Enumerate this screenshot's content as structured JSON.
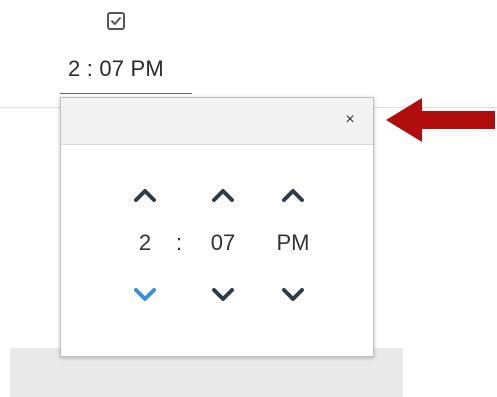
{
  "field": {
    "time_display": "2 : 07 PM",
    "checkbox_checked": true
  },
  "picker": {
    "close_label": "×",
    "hour": "2",
    "separator": ":",
    "minute": "07",
    "meridian": "PM"
  },
  "icons": {
    "up": "chevron-up-icon",
    "down": "chevron-down-icon",
    "close": "close-icon",
    "checkbox": "checkbox-icon",
    "arrow": "red-arrow-left-icon"
  },
  "colors": {
    "chevron": "#2e3b48",
    "chevron_active": "#3a8fd9",
    "arrow": "#b10d0d"
  }
}
